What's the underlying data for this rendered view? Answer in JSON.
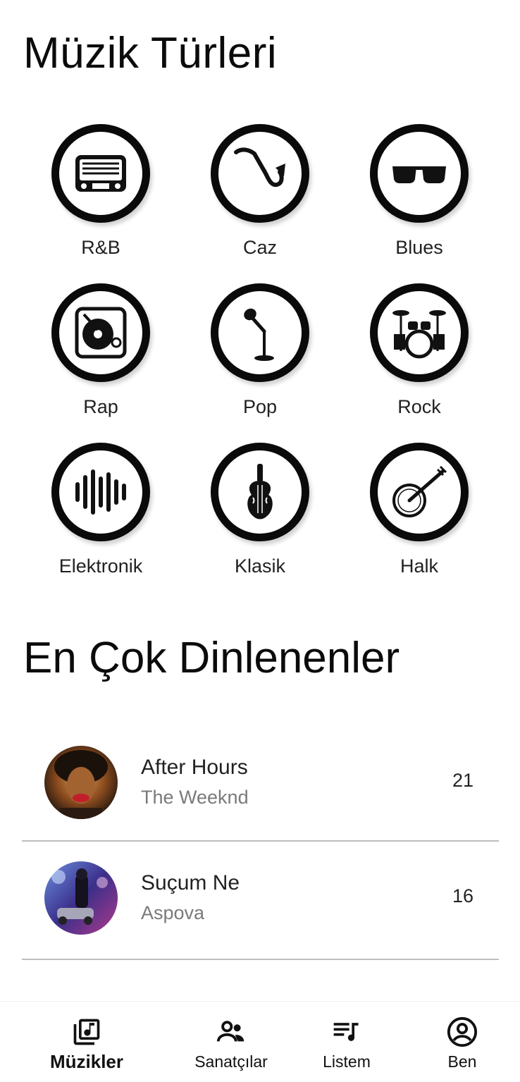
{
  "header": {
    "title": "Müzik Türleri"
  },
  "genres": [
    {
      "label": "R&B",
      "icon": "radio-icon"
    },
    {
      "label": "Caz",
      "icon": "saxophone-icon"
    },
    {
      "label": "Blues",
      "icon": "sunglasses-icon"
    },
    {
      "label": "Rap",
      "icon": "turntable-icon"
    },
    {
      "label": "Pop",
      "icon": "microphone-icon"
    },
    {
      "label": "Rock",
      "icon": "drum-kit-icon"
    },
    {
      "label": "Elektronik",
      "icon": "equalizer-icon"
    },
    {
      "label": "Klasik",
      "icon": "violin-icon"
    },
    {
      "label": "Halk",
      "icon": "banjo-icon"
    }
  ],
  "top_listened": {
    "title": "En Çok Dinlenenler",
    "songs": [
      {
        "title": "After Hours",
        "artist": "The Weeknd",
        "count": "21"
      },
      {
        "title": "Suçum Ne",
        "artist": "Aspova",
        "count": "16"
      }
    ]
  },
  "bottom_nav": {
    "items": [
      {
        "label": "Müzikler",
        "icon": "music-library-icon",
        "active": true
      },
      {
        "label": "Sanatçılar",
        "icon": "people-icon",
        "active": false
      },
      {
        "label": "Listem",
        "icon": "playlist-icon",
        "active": false
      },
      {
        "label": "Ben",
        "icon": "account-circle-icon",
        "active": false
      }
    ]
  }
}
